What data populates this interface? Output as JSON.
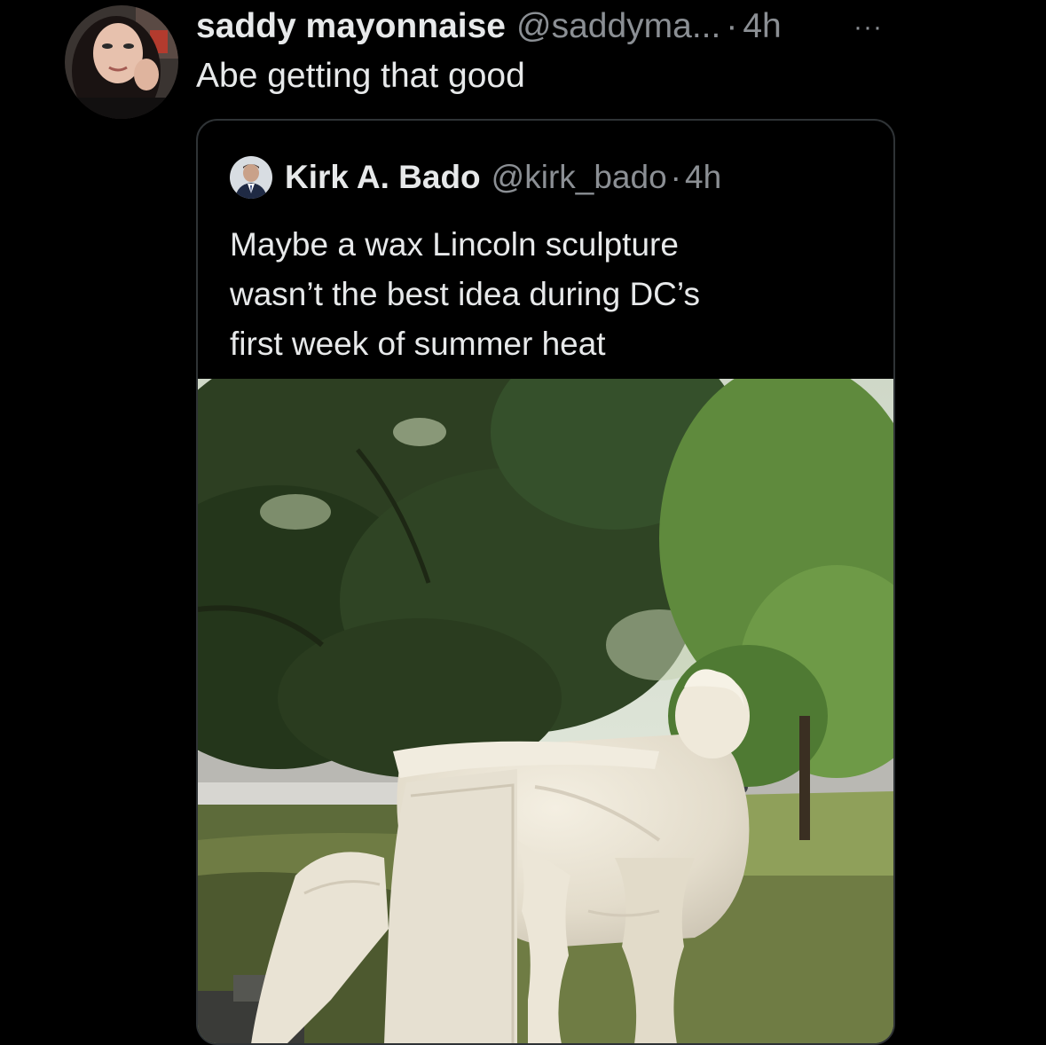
{
  "tweet": {
    "display_name": "saddy mayonnaise",
    "handle": "@saddyma...",
    "separator": "·",
    "time": "4h",
    "more_label": "···",
    "text": "Abe getting that good"
  },
  "quote": {
    "display_name": "Kirk A. Bado",
    "handle": "@kirk_bado",
    "separator": "·",
    "time": "4h",
    "text_lines": [
      "Maybe a wax Lincoln sculpture",
      "wasn’t the best idea during DC’s",
      "first week of summer heat"
    ]
  },
  "colors": {
    "background": "#000000",
    "primary_text": "#e7e9ea",
    "secondary_text": "#8b8f94",
    "border": "#2f3336"
  },
  "icons": {
    "more": "more-horizontal-icon"
  }
}
